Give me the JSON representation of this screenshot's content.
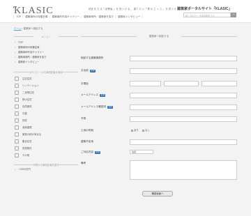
{
  "header": {
    "logo": "KLASIC",
    "tagline": "何証 を ち る「 創業者 」 を 見つ け る 、 建て た い「 理 の 工 っ ス 」 を 見つ け る。",
    "site_name": "建築家ポータルサイト「KLASIC」",
    "search_placeholder": "新しなのちー 写真&検索 テル",
    "search_button": "›"
  },
  "nav": [
    "TOP",
    "建築事例の特集記事",
    "建築事例写真ギャラリー",
    "建築事例所・建築家を探す",
    "建築家インタビュー"
  ],
  "breadcrumb": {
    "home": "ホーム",
    "sep": "›",
    "current": "建築家へ相談する"
  },
  "sidebar": {
    "menu_head": "メニュー",
    "menu": [
      "TOP",
      "建築事例の特集記事",
      "建築事例写真ギャラリー",
      "建築事務所・建築家を探す",
      "建築家インタビュー"
    ],
    "cat_head": "カテゴリーから事例記事を見る",
    "categories": [
      "注文住宅",
      "リノベーション",
      "二世帯住宅",
      "狭小住宅",
      "自然素材",
      "平屋",
      "別荘",
      "収納重視",
      "家族の絆が深まる",
      "集合住宅",
      "賃貸物件",
      "その他"
    ],
    "price_head": "予算から事例記事を探す",
    "price_first": "～2000万円"
  },
  "form": {
    "title": "建築家へ相談する",
    "fields": {
      "architect": "相談する建築事務所",
      "name": "お名前",
      "phone": "お電話",
      "email": "メールアドレス",
      "email_confirm": "メールアドレス確認用",
      "budget": "予算",
      "land": "土地の有無",
      "address": "建築予定地",
      "contact": "ご対応内容",
      "note": "備考"
    },
    "required_label": "必須",
    "land_options": [
      "あり",
      "なし"
    ],
    "contact_select": "電話",
    "submit": "確認画面へ"
  }
}
